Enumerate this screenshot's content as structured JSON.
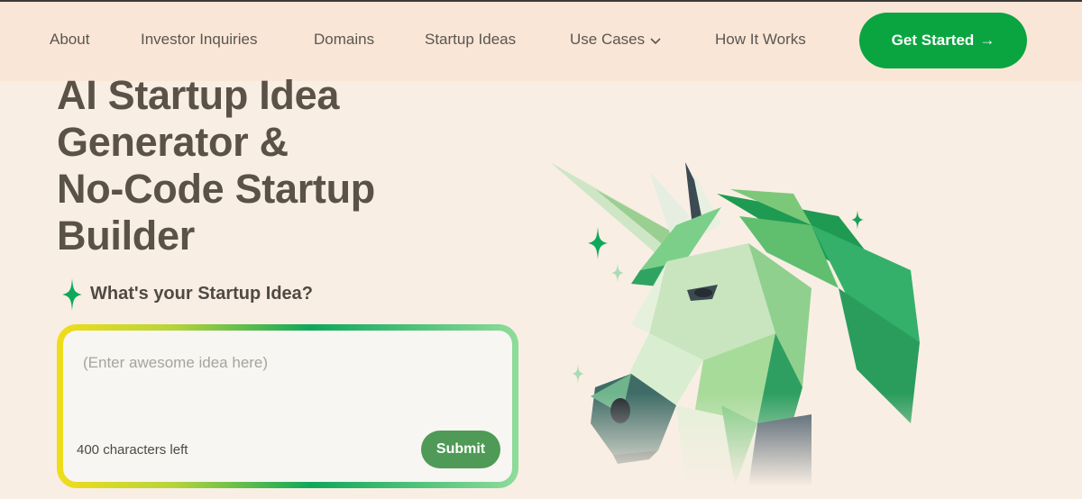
{
  "nav": {
    "links": [
      "About",
      "Investor Inquiries",
      "Domains",
      "Startup Ideas",
      "Use Cases",
      "How It Works"
    ],
    "cta_label": "Get Started",
    "cta_arrow": "→"
  },
  "hero": {
    "title_lines": [
      "AI Startup Idea",
      "Generator &",
      "No-Code Startup",
      "Builder"
    ],
    "question": "What's your Startup Idea?"
  },
  "idea_form": {
    "placeholder": "(Enter awesome idea here)",
    "value": "",
    "chars_left": "400 characters left",
    "submit_label": "Submit"
  },
  "colors": {
    "accent": "#0aa540",
    "submit": "#4e9a56",
    "background": "#f9eee4",
    "navbar": "#f9e6d6",
    "heading": "#5a5247"
  },
  "icons": {
    "sparkle": "sparkle-icon",
    "dropdown": "chevron-down-icon",
    "illustration": "unicorn-illustration"
  }
}
